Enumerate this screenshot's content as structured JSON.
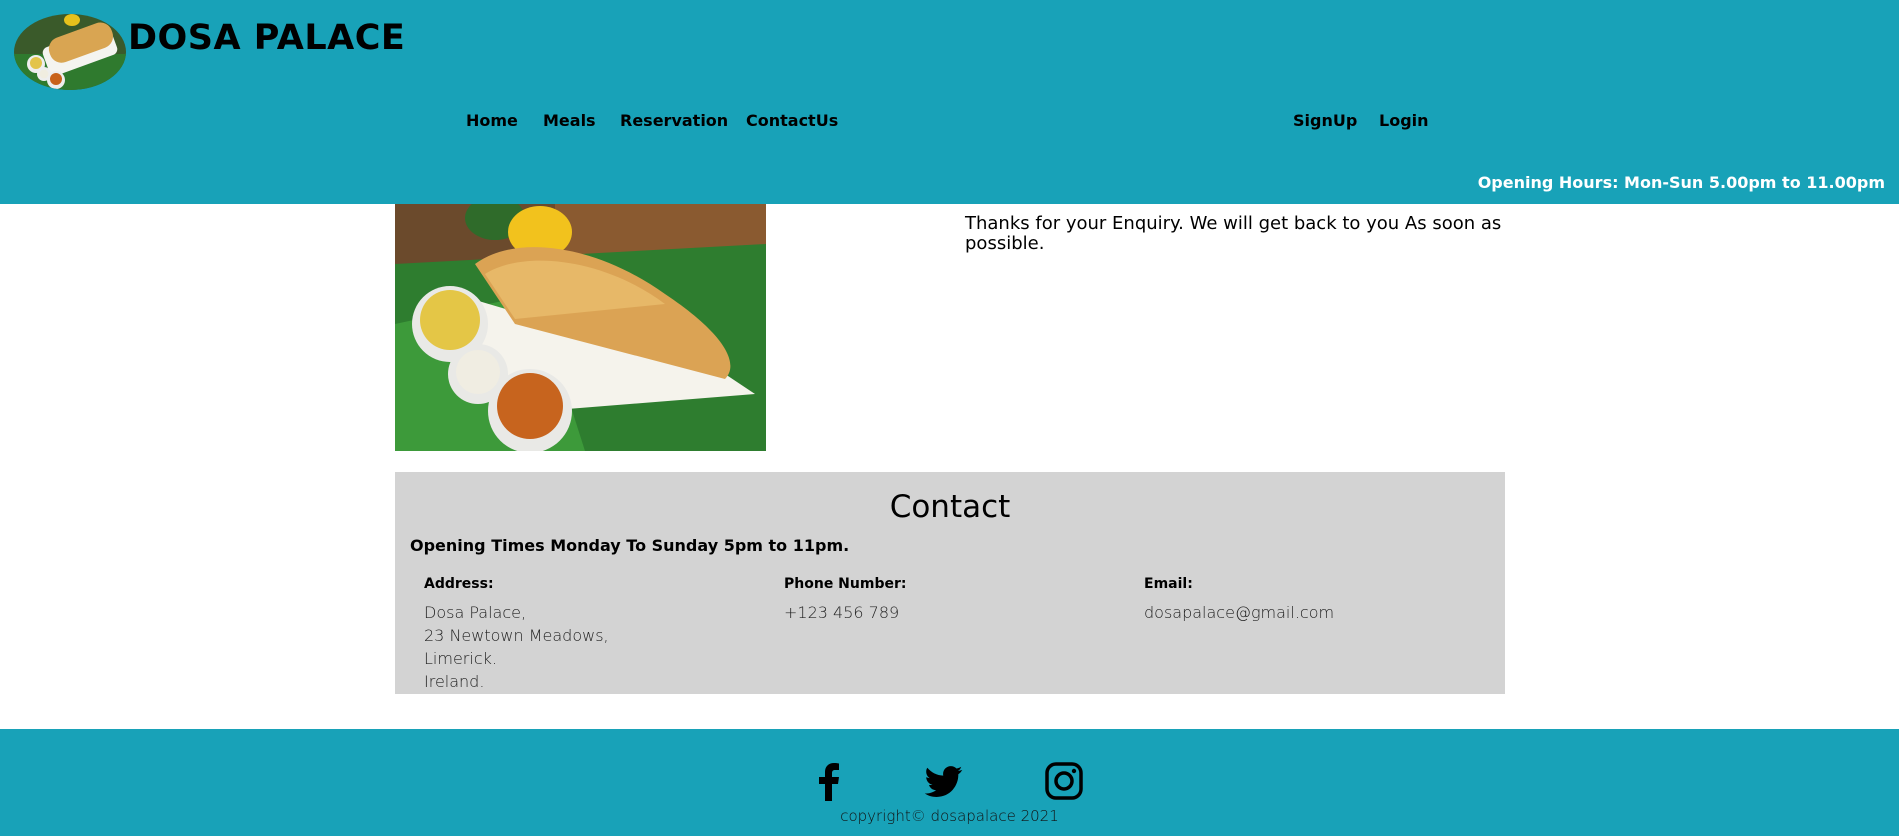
{
  "header": {
    "brand": "DOSA PALACE",
    "nav_left": [
      "Home",
      "Meals",
      "Reservation",
      "ContactUs"
    ],
    "nav_right": [
      "SignUp",
      "Login"
    ],
    "opening_hours": "Opening Hours: Mon-Sun 5.00pm to 11.00pm"
  },
  "main": {
    "message": "Thanks for your Enquiry. We will get back to you As soon as possible."
  },
  "contact": {
    "title": "Contact",
    "times": "Opening Times Monday To Sunday 5pm to 11pm.",
    "address_label": "Address:",
    "address_lines": [
      "Dosa Palace,",
      "23 Newtown Meadows,",
      "Limerick.",
      "Ireland."
    ],
    "phone_label": "Phone Number:",
    "phone": "+123 456 789",
    "email_label": "Email:",
    "email": "dosapalace@gmail.com"
  },
  "footer": {
    "social_icons": [
      "facebook-icon",
      "twitter-icon",
      "instagram-icon"
    ],
    "copyright": "copyright© dosapalace 2021"
  },
  "colors": {
    "header_bg": "#18a2b8",
    "contact_bg": "#d3d3d3",
    "hours_text": "#ffffff"
  }
}
